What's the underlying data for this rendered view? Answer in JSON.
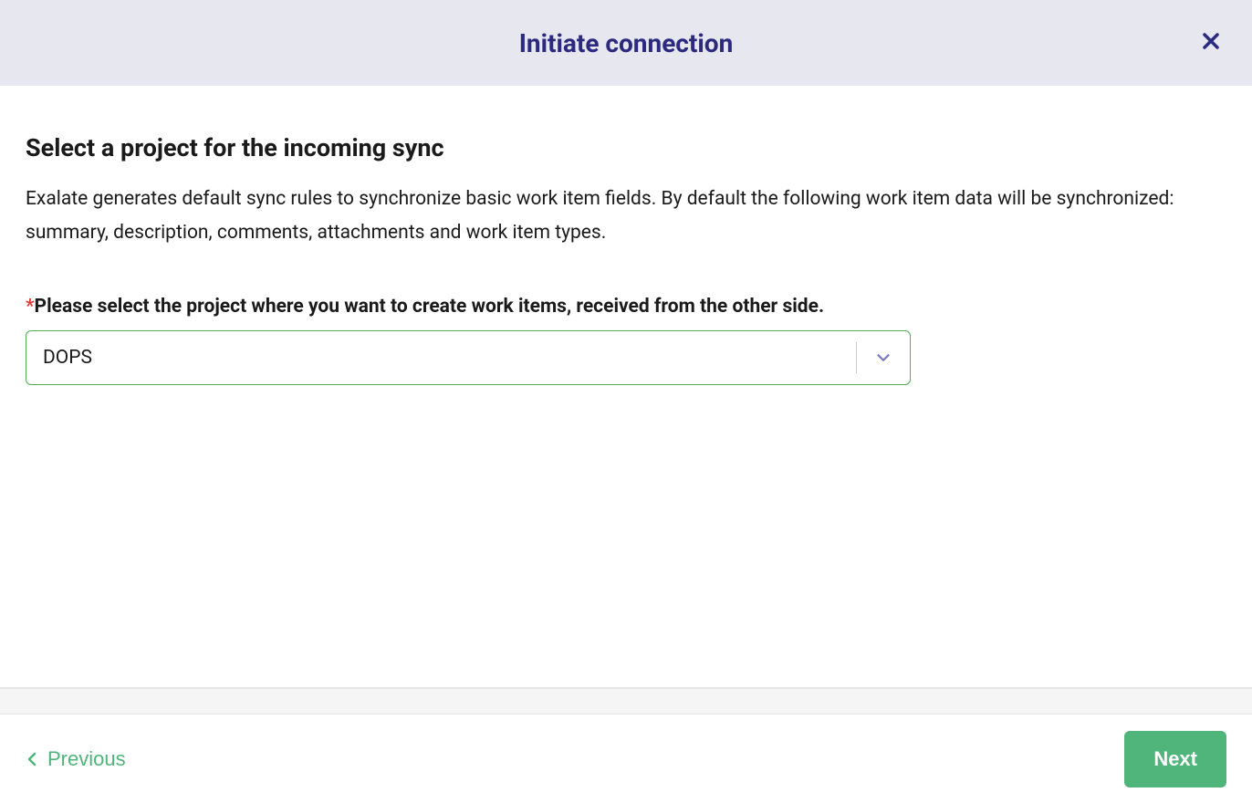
{
  "header": {
    "title": "Initiate connection"
  },
  "content": {
    "section_title": "Select a project for the incoming sync",
    "description": "Exalate generates default sync rules to synchronize basic work item fields. By default the following work item data will be synchronized: summary, description, comments, attachments and work item types.",
    "field_label": "Please select the project where you want to create work items, received from the other side.",
    "select_value": "DOPS"
  },
  "footer": {
    "previous_label": "Previous",
    "next_label": "Next"
  }
}
